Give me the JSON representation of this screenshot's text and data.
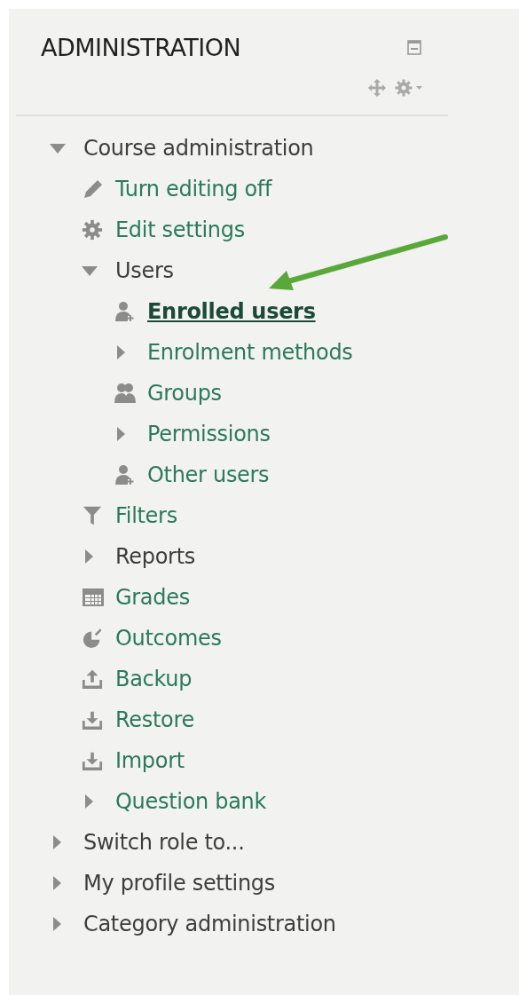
{
  "block": {
    "title": "ADMINISTRATION"
  },
  "tree": [
    {
      "kind": "branch",
      "label": "Course administration",
      "link": false,
      "expanded": true,
      "selected": false,
      "children": [
        {
          "kind": "edit",
          "label": "Turn editing off",
          "selected": false
        },
        {
          "kind": "settings",
          "label": "Edit settings",
          "selected": false
        },
        {
          "kind": "branch",
          "label": "Users",
          "link": false,
          "expanded": true,
          "selected": false,
          "children": [
            {
              "kind": "user-add",
              "label": "Enrolled users",
              "selected": true
            },
            {
              "kind": "branch",
              "label": "Enrolment methods",
              "link": true,
              "expanded": false,
              "selected": false
            },
            {
              "kind": "group",
              "label": "Groups",
              "selected": false
            },
            {
              "kind": "branch",
              "label": "Permissions",
              "link": true,
              "expanded": false,
              "selected": false
            },
            {
              "kind": "user-add",
              "label": "Other users",
              "selected": false
            }
          ]
        },
        {
          "kind": "filter",
          "label": "Filters",
          "selected": false
        },
        {
          "kind": "branch",
          "label": "Reports",
          "link": false,
          "expanded": false,
          "selected": false
        },
        {
          "kind": "grades",
          "label": "Grades",
          "selected": false
        },
        {
          "kind": "outcomes",
          "label": "Outcomes",
          "selected": false
        },
        {
          "kind": "backup",
          "label": "Backup",
          "selected": false
        },
        {
          "kind": "restore",
          "label": "Restore",
          "selected": false
        },
        {
          "kind": "restore",
          "label": "Import",
          "selected": false
        },
        {
          "kind": "branch",
          "label": "Question bank",
          "link": true,
          "expanded": false,
          "selected": false
        }
      ]
    },
    {
      "kind": "branch",
      "label": "Switch role to...",
      "link": false,
      "expanded": false,
      "selected": false
    },
    {
      "kind": "branch",
      "label": "My profile settings",
      "link": false,
      "expanded": false,
      "selected": false
    },
    {
      "kind": "branch",
      "label": "Category administration",
      "link": false,
      "expanded": false,
      "selected": false
    }
  ]
}
